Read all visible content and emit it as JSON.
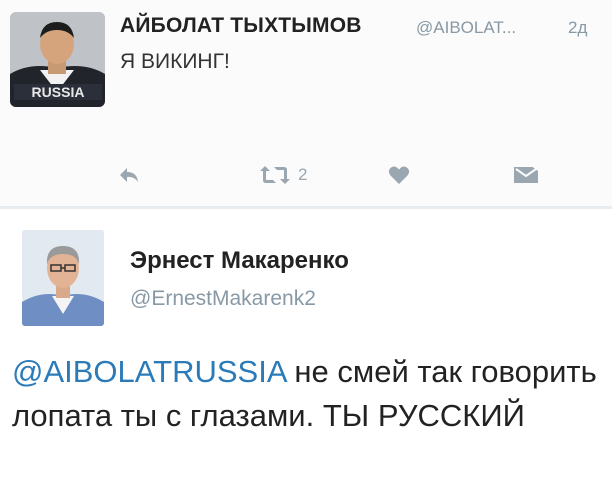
{
  "tweet1": {
    "name": "АЙБОЛАТ ТЫХТЫМОВ",
    "handle": "@AIBOLAT...",
    "time": "2д",
    "text": "Я ВИКИНГ!",
    "avatar_shirt_text": "RUSSIA",
    "actions": {
      "reply_icon": "reply-icon",
      "retweet_icon": "retweet-icon",
      "retweet_count": "2",
      "like_icon": "heart-icon",
      "dm_icon": "direct-message-icon"
    }
  },
  "tweet2": {
    "name": "Эрнест Макаренко",
    "handle": "@ErnestMakarenk2",
    "mention": "@AIBOLATRUSSIA",
    "text": " не смей так говорить лопата ты с глазами.  ТЫ РУССКИЙ"
  },
  "colors": {
    "link": "#2b7bb9",
    "muted": "#8899a6",
    "divider": "#e6ecf0"
  }
}
